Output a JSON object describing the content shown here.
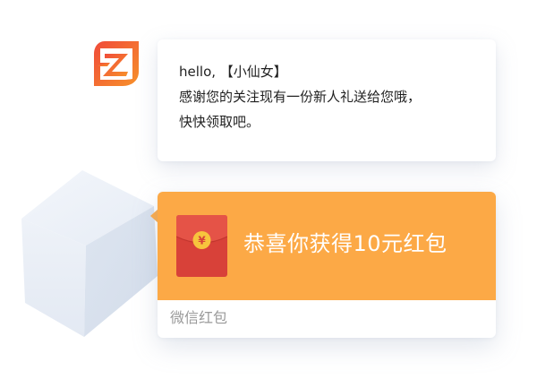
{
  "message": {
    "greeting": "hello, 【小仙女】",
    "line2": "感谢您的关注现有一份新人礼送给您哦，",
    "line3": "快快领取吧。"
  },
  "red_packet": {
    "title": "恭喜你获得10元红包",
    "footer": "微信红包",
    "currency_symbol": "¥"
  },
  "colors": {
    "packet_orange": "#fca946",
    "envelope_red": "#d84139",
    "coin_gold": "#f7c43d",
    "logo_red": "#f04a3a",
    "logo_orange": "#f7912a"
  },
  "icons": {
    "logo": "z-leaf-logo-icon",
    "envelope": "red-envelope-icon",
    "cube": "cube-decoration"
  }
}
